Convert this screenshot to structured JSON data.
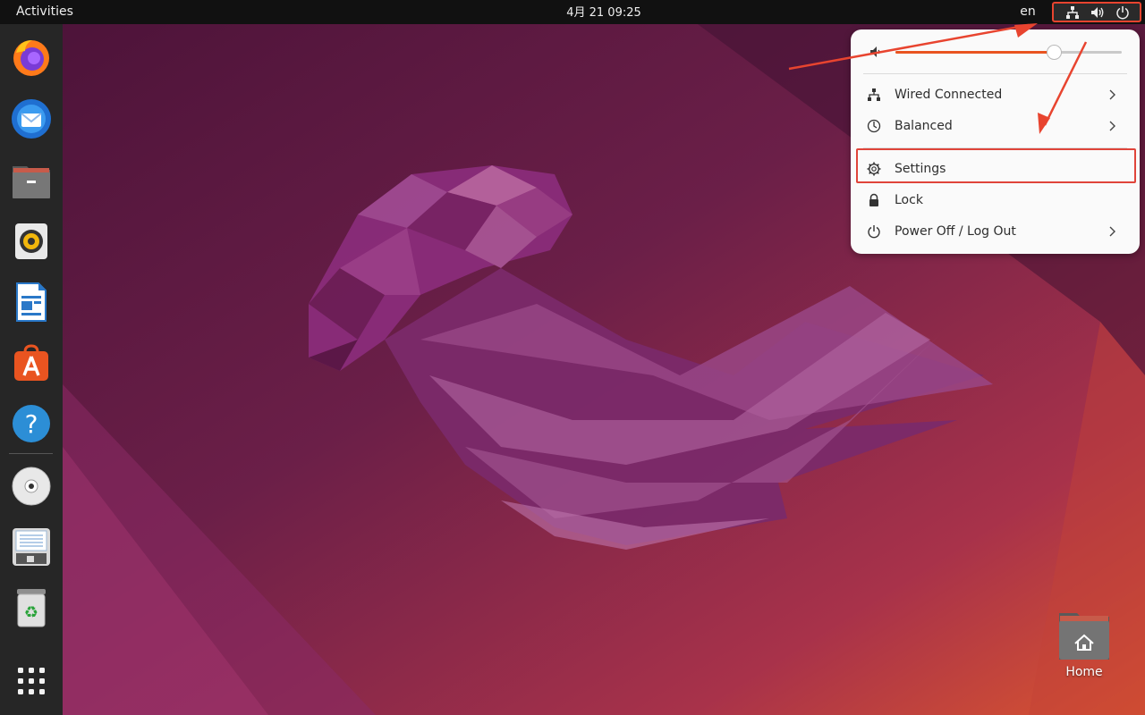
{
  "topbar": {
    "activities_label": "Activities",
    "clock": "4月 21  09:25",
    "keyboard_layout": "en",
    "indicators": [
      "network-icon",
      "volume-icon",
      "power-icon"
    ]
  },
  "dock": {
    "items": [
      {
        "name": "firefox",
        "icon": "firefox-icon"
      },
      {
        "name": "thunderbird",
        "icon": "thunderbird-icon"
      },
      {
        "name": "files",
        "icon": "files-icon"
      },
      {
        "name": "rhythmbox",
        "icon": "rhythmbox-icon"
      },
      {
        "name": "libreoffice-writer",
        "icon": "writer-icon"
      },
      {
        "name": "ubuntu-software",
        "icon": "software-icon"
      },
      {
        "name": "help",
        "icon": "help-icon"
      },
      {
        "name": "disc",
        "icon": "disc-icon"
      },
      {
        "name": "removable-drive",
        "icon": "drive-icon"
      },
      {
        "name": "trash",
        "icon": "trash-icon"
      },
      {
        "name": "show-applications",
        "icon": "app-grid-icon"
      }
    ]
  },
  "quick_settings": {
    "volume_level": 0.7,
    "items": [
      {
        "label": "Wired Connected",
        "icon": "network-wired-icon",
        "has_submenu": true
      },
      {
        "label": "Balanced",
        "icon": "power-profile-icon",
        "has_submenu": true
      },
      {
        "label": "Settings",
        "icon": "gear-icon",
        "has_submenu": false,
        "highlighted": true
      },
      {
        "label": "Lock",
        "icon": "lock-icon",
        "has_submenu": false
      },
      {
        "label": "Power Off / Log Out",
        "icon": "power-icon",
        "has_submenu": true
      }
    ]
  },
  "desktop": {
    "home_label": "Home"
  },
  "colors": {
    "accent": "#e95420",
    "annotation": "#e0443a",
    "topbar": "#111111",
    "dock": "#262626",
    "menu_bg": "#fafafa"
  }
}
